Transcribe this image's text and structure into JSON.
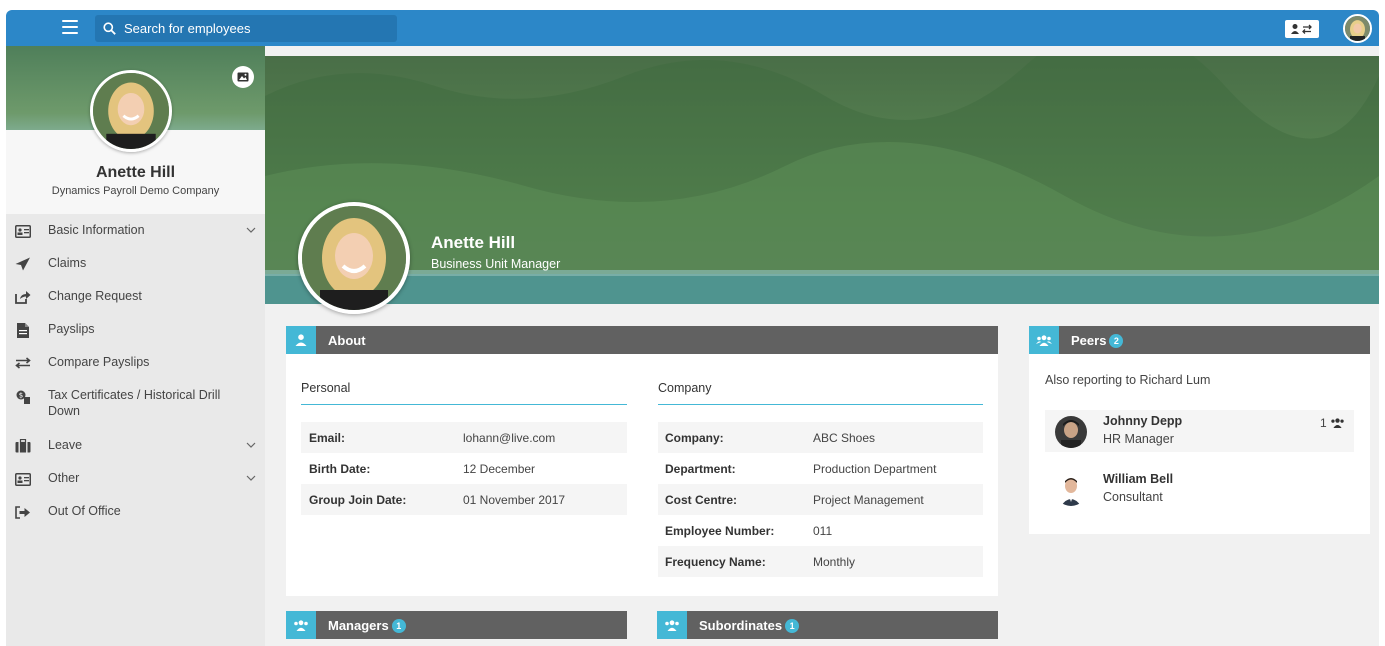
{
  "topbar": {
    "search_placeholder": "Search for employees"
  },
  "profile": {
    "name": "Anette Hill",
    "company": "Dynamics Payroll Demo Company",
    "title": "Business Unit Manager"
  },
  "menu": [
    {
      "label": "Basic Information",
      "icon": "id-card-icon",
      "expandable": true
    },
    {
      "label": "Claims",
      "icon": "paper-plane-icon",
      "expandable": false
    },
    {
      "label": "Change Request",
      "icon": "share-icon",
      "expandable": false
    },
    {
      "label": "Payslips",
      "icon": "file-icon",
      "expandable": false
    },
    {
      "label": "Compare Payslips",
      "icon": "exchange-icon",
      "expandable": false
    },
    {
      "label": "Tax Certificates / Historical Drill Down",
      "icon": "money-search-icon",
      "expandable": false
    },
    {
      "label": "Leave",
      "icon": "suitcase-icon",
      "expandable": true
    },
    {
      "label": "Other",
      "icon": "id-card-icon",
      "expandable": true
    },
    {
      "label": "Out Of Office",
      "icon": "sign-out-icon",
      "expandable": false
    }
  ],
  "about": {
    "heading": "About",
    "personal": {
      "title": "Personal",
      "rows": [
        {
          "key": "Email:",
          "value": "lohann@live.com"
        },
        {
          "key": "Birth Date:",
          "value": "12 December"
        },
        {
          "key": "Group Join Date:",
          "value": "01 November 2017"
        }
      ]
    },
    "company": {
      "title": "Company",
      "rows": [
        {
          "key": "Company:",
          "value": "ABC Shoes"
        },
        {
          "key": "Department:",
          "value": "Production Department"
        },
        {
          "key": "Cost Centre:",
          "value": "Project Management"
        },
        {
          "key": "Employee Number:",
          "value": "011"
        },
        {
          "key": "Frequency Name:",
          "value": "Monthly"
        }
      ]
    }
  },
  "peers": {
    "heading": "Peers",
    "count": "2",
    "reporting_text": "Also reporting to Richard Lum",
    "items": [
      {
        "name": "Johnny Depp",
        "title": "HR Manager",
        "count": "1"
      },
      {
        "name": "William Bell",
        "title": "Consultant"
      }
    ]
  },
  "managers": {
    "heading": "Managers",
    "count": "1"
  },
  "subordinates": {
    "heading": "Subordinates",
    "count": "1"
  },
  "colors": {
    "topbar": "#2c87c8",
    "accent": "#44b8d6",
    "panel_header": "#616161"
  }
}
